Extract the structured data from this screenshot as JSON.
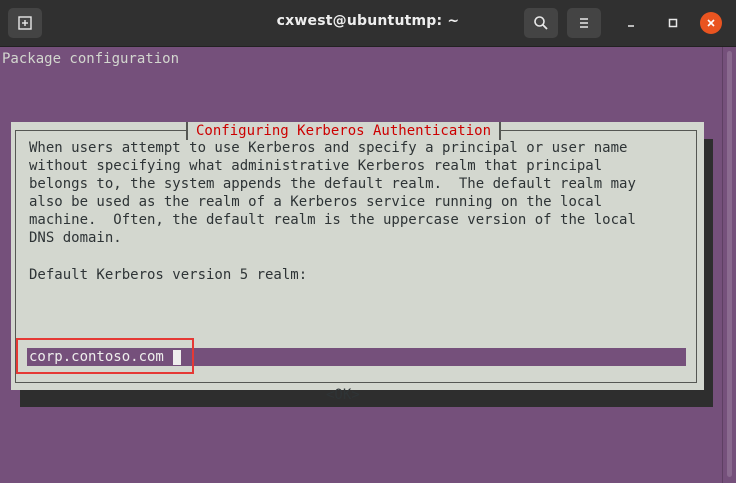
{
  "window": {
    "title": "cxwest@ubuntutmp: ~"
  },
  "terminal": {
    "header_text": "Package configuration"
  },
  "dialog": {
    "title": "Configuring Kerberos Authentication",
    "body": "When users attempt to use Kerberos and specify a principal or user name\nwithout specifying what administrative Kerberos realm that principal\nbelongs to, the system appends the default realm.  The default realm may\nalso be used as the realm of a Kerberos service running on the local\nmachine.  Often, the default realm is the uppercase version of the local\nDNS domain.",
    "realm_label": "Default Kerberos version 5 realm:",
    "realm_value": "corp.contoso.com",
    "ok_label": "<OK>"
  },
  "colors": {
    "terminal_background": "#75507b",
    "dialog_background": "#d3d7cf",
    "dialog_title": "#cc0000",
    "highlight": "#e53935",
    "close_button": "#e95420"
  },
  "icons": [
    "new-tab-icon",
    "search-icon",
    "hamburger-menu-icon",
    "minimize-icon",
    "maximize-icon",
    "close-icon"
  ]
}
